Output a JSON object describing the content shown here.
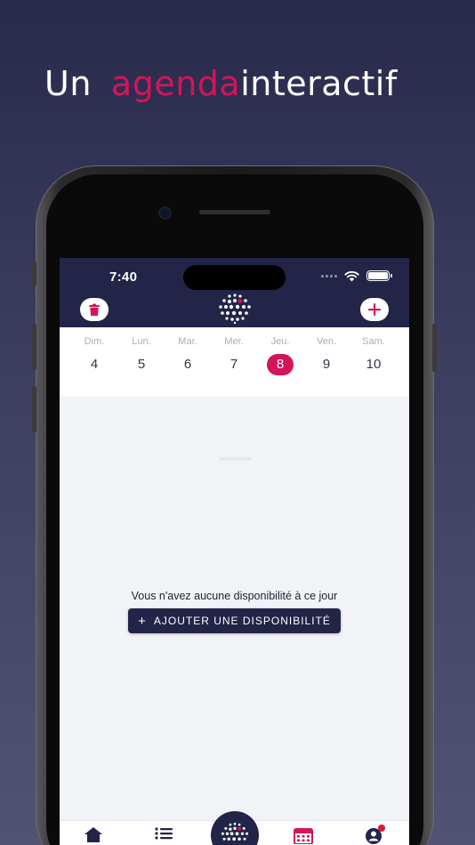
{
  "headline": {
    "word1": "Un",
    "word2": "agenda",
    "word3": "interactif"
  },
  "status_bar": {
    "time": "7:40"
  },
  "week": [
    {
      "name": "Dim.",
      "date": "4"
    },
    {
      "name": "Lun.",
      "date": "5"
    },
    {
      "name": "Mar.",
      "date": "6"
    },
    {
      "name": "Mer.",
      "date": "7"
    },
    {
      "name": "Jeu.",
      "date": "8",
      "selected": true
    },
    {
      "name": "Ven.",
      "date": "9"
    },
    {
      "name": "Sam.",
      "date": "10"
    }
  ],
  "empty_state": {
    "message": "Vous n'avez aucune disponibilité à ce jour",
    "add_button_icon": "+",
    "add_button_label": "AJOUTER UNE DISPONIBILITÉ"
  },
  "icons": {
    "top_left": "trash-icon",
    "top_right": "plus-icon",
    "tabs": [
      "home-icon",
      "list-icon",
      "logo-icon",
      "calendar-icon",
      "profile-icon"
    ]
  },
  "colors": {
    "brand_navy": "#222448",
    "accent": "#d4145a",
    "background_top": "#292a4b",
    "background_bottom": "#505373"
  }
}
